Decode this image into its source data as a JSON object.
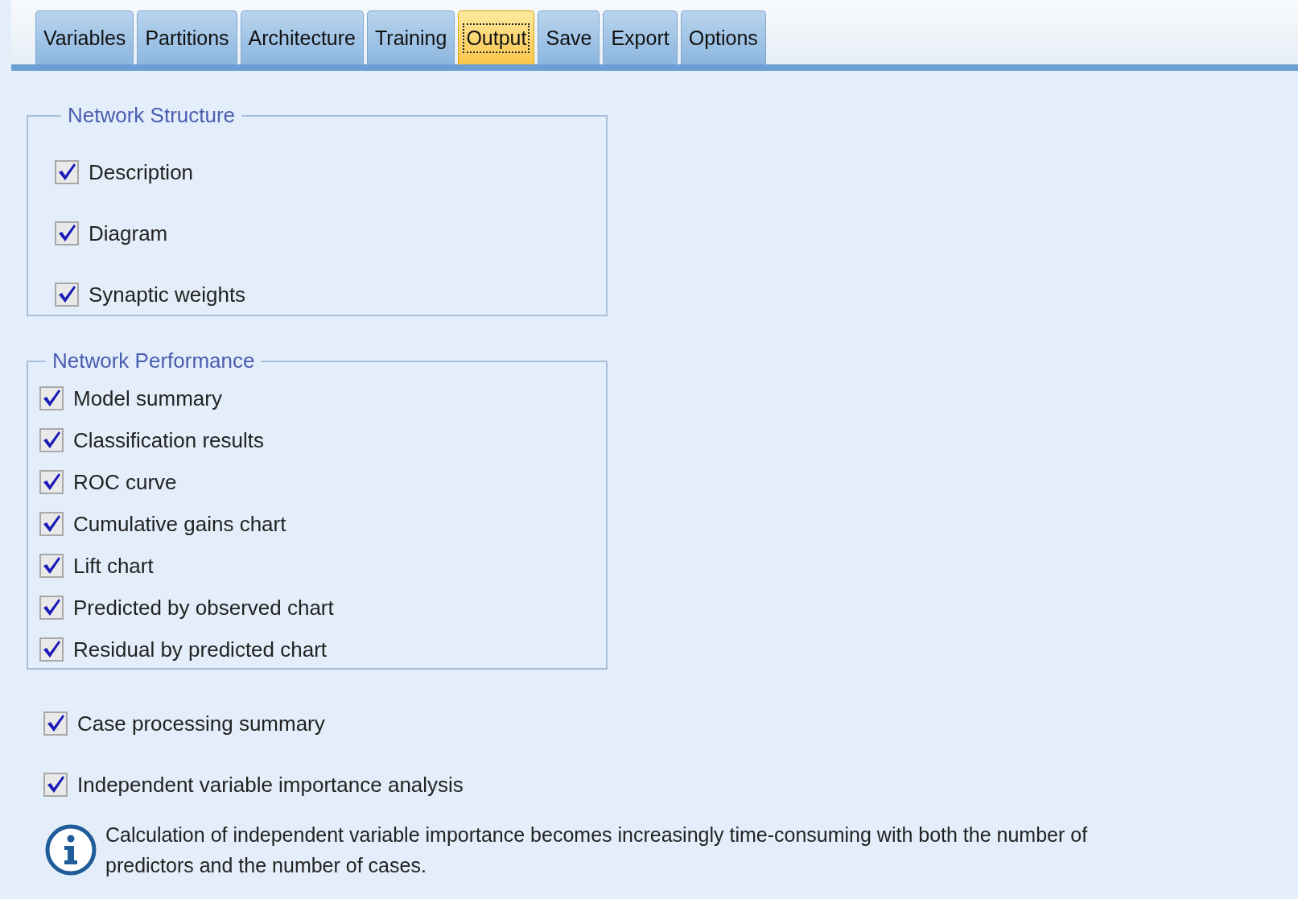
{
  "tabs": [
    {
      "label": "Variables",
      "selected": false
    },
    {
      "label": "Partitions",
      "selected": false
    },
    {
      "label": "Architecture",
      "selected": false
    },
    {
      "label": "Training",
      "selected": false
    },
    {
      "label": "Output",
      "selected": true
    },
    {
      "label": "Save",
      "selected": false
    },
    {
      "label": "Export",
      "selected": false
    },
    {
      "label": "Options",
      "selected": false
    }
  ],
  "groups": [
    {
      "title": "Network Structure",
      "items": [
        {
          "label": "Description",
          "checked": true
        },
        {
          "label": "Diagram",
          "checked": true
        },
        {
          "label": "Synaptic weights",
          "checked": true
        }
      ]
    },
    {
      "title": "Network Performance",
      "items": [
        {
          "label": "Model summary",
          "checked": true
        },
        {
          "label": "Classification results",
          "checked": true
        },
        {
          "label": "ROC curve",
          "checked": true
        },
        {
          "label": "Cumulative gains chart",
          "checked": true
        },
        {
          "label": "Lift chart",
          "checked": true
        },
        {
          "label": "Predicted by observed chart",
          "checked": true
        },
        {
          "label": "Residual by predicted chart",
          "checked": true
        }
      ]
    }
  ],
  "options": [
    {
      "label": "Case processing summary",
      "checked": true
    },
    {
      "label": "Independent variable importance analysis",
      "checked": true
    }
  ],
  "note": "Calculation of independent variable importance becomes increasingly time-consuming with both the number of predictors and the number of cases."
}
